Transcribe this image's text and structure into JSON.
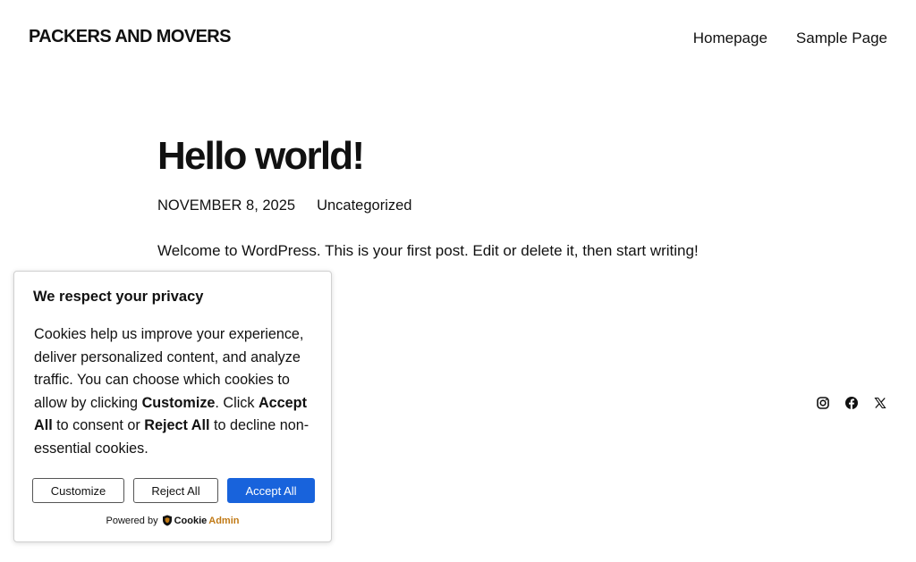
{
  "header": {
    "site_title": "PACKERS AND MOVERS",
    "nav": [
      {
        "label": "Homepage"
      },
      {
        "label": "Sample Page"
      }
    ]
  },
  "post": {
    "title": "Hello world!",
    "date": "NOVEMBER 8, 2025",
    "category": "Uncategorized",
    "body": "Welcome to WordPress. This is your first post. Edit or delete it, then start writing!"
  },
  "social": {
    "icons": [
      "instagram-icon",
      "facebook-icon",
      "x-icon"
    ]
  },
  "cookie": {
    "title": "We respect your privacy",
    "text_1": "Cookies help us improve your experience, deliver personalized content, and analyze traffic. You can choose which cookies to allow by clicking ",
    "customize_bold": "Customize",
    "text_2": ". Click ",
    "accept_bold": "Accept All",
    "text_3": " to consent or ",
    "reject_bold": "Reject All",
    "text_4": " to decline non-essential cookies.",
    "buttons": {
      "customize": "Customize",
      "reject": "Reject All",
      "accept": "Accept All"
    },
    "powered_by": "Powered by",
    "brand_part1": "Cookie",
    "brand_part2": "Admin",
    "accent_color": "#1863dc"
  }
}
